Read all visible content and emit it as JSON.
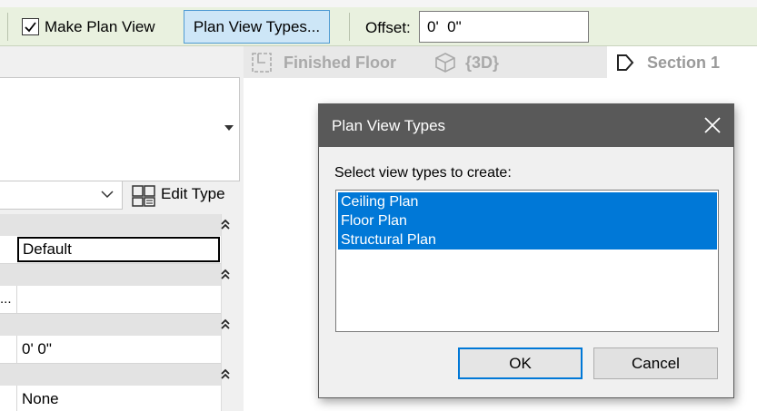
{
  "options_bar": {
    "make_plan_view_label": "Make Plan View",
    "make_plan_view_checked": true,
    "plan_view_types_button": "Plan View Types...",
    "offset_label": "Offset:",
    "offset_value": "0'  0\""
  },
  "properties": {
    "edit_type_label": "Edit Type",
    "rows": {
      "default": "Default",
      "ellipsis": "...",
      "offset": "0'  0\"",
      "none": "None"
    }
  },
  "view_tabs": [
    {
      "label": "Finished Floor",
      "icon": "floor-plan-icon"
    },
    {
      "label": "{3D}",
      "icon": "3d-view-icon"
    },
    {
      "label": "Section 1",
      "icon": "section-view-icon"
    }
  ],
  "dialog": {
    "title": "Plan View Types",
    "prompt": "Select view types to create:",
    "items": [
      "Ceiling Plan",
      "Floor Plan",
      "Structural Plan"
    ],
    "ok_label": "OK",
    "cancel_label": "Cancel",
    "selection_color": "#0078d7"
  },
  "colors": {
    "options_bar_bg": "#e9f1df",
    "active_button_bg": "#cde6f7",
    "dialog_titlebar": "#595959"
  }
}
